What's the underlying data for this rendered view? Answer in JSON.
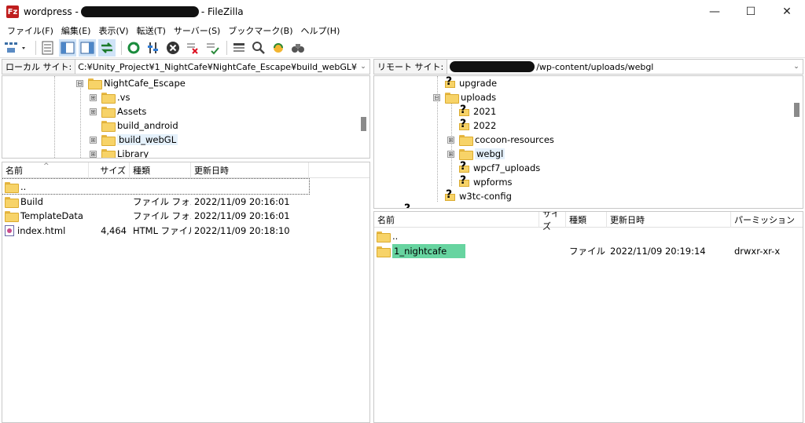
{
  "window": {
    "title_prefix": "wordpress -",
    "title_suffix": "- FileZilla",
    "app_icon": "Fz",
    "minimize": "—",
    "maximize": "☐",
    "close": "✕"
  },
  "menu": [
    "ファイル(F)",
    "編集(E)",
    "表示(V)",
    "転送(T)",
    "サーバー(S)",
    "ブックマーク(B)",
    "ヘルプ(H)"
  ],
  "local": {
    "label": "ローカル サイト:",
    "path": "C:¥Unity_Project¥1_NightCafe¥NightCafe_Escape¥build_webGL¥",
    "tree": [
      {
        "name": "NightCafe_Escape",
        "expander": "⊟"
      },
      {
        "name": ".vs",
        "expander": "⊞"
      },
      {
        "name": "Assets",
        "expander": "⊞"
      },
      {
        "name": "build_android",
        "expander": ""
      },
      {
        "name": "build_webGL",
        "expander": "⊞"
      },
      {
        "name": "Library",
        "expander": "⊞"
      }
    ],
    "columns": {
      "name": "名前",
      "size": "サイズ",
      "type": "種類",
      "modified": "更新日時"
    },
    "files": [
      {
        "name": "..",
        "size": "",
        "type": "",
        "modified": ""
      },
      {
        "name": "Build",
        "size": "",
        "type": "ファイル フォル...",
        "modified": "2022/11/09 20:16:01"
      },
      {
        "name": "TemplateData",
        "size": "",
        "type": "ファイル フォル...",
        "modified": "2022/11/09 20:16:01"
      },
      {
        "name": "index.html",
        "size": "4,464",
        "type": "HTML ファイル",
        "modified": "2022/11/09 20:18:10"
      }
    ]
  },
  "remote": {
    "label": "リモート サイト:",
    "path_suffix": "/wp-content/uploads/webgl",
    "tree": [
      {
        "name": "upgrade",
        "icon": "unknown",
        "expander": ""
      },
      {
        "name": "uploads",
        "icon": "folder",
        "expander": "⊟"
      },
      {
        "name": "2021",
        "icon": "unknown",
        "expander": ""
      },
      {
        "name": "2022",
        "icon": "unknown",
        "expander": ""
      },
      {
        "name": "cocoon-resources",
        "icon": "folder",
        "expander": "⊞"
      },
      {
        "name": "webgl",
        "icon": "folder",
        "expander": "⊞"
      },
      {
        "name": "wpcf7_uploads",
        "icon": "unknown",
        "expander": ""
      },
      {
        "name": "wpforms",
        "icon": "unknown",
        "expander": ""
      },
      {
        "name": "w3tc-config",
        "icon": "unknown",
        "expander": ""
      }
    ],
    "columns": {
      "name": "名前",
      "size": "サイズ",
      "type": "種類",
      "modified": "更新日時",
      "permission": "パーミッション"
    },
    "files": [
      {
        "name": "..",
        "type": "",
        "modified": "",
        "permission": ""
      },
      {
        "name": "1_nightcafe",
        "type": "ファイル ...",
        "modified": "2022/11/09 20:19:14",
        "permission": "drwxr-xr-x"
      }
    ]
  }
}
